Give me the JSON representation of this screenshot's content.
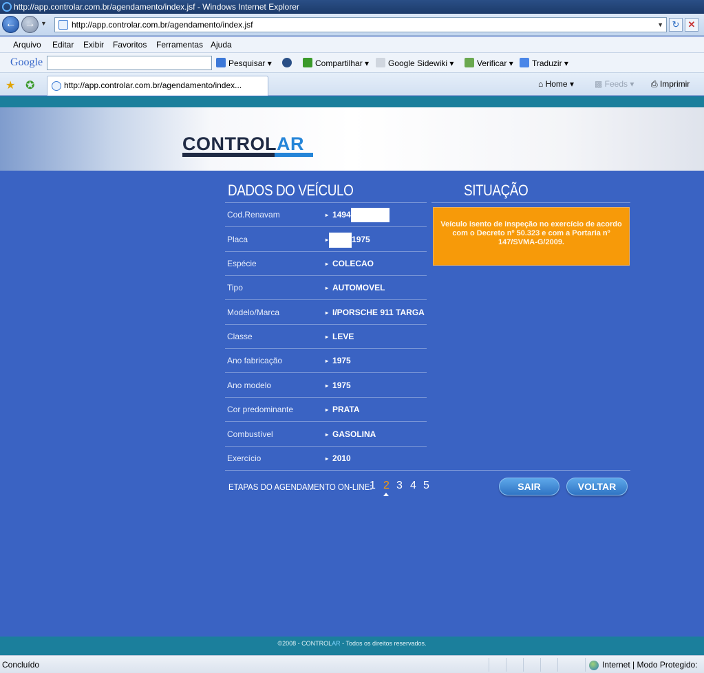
{
  "browser": {
    "window_title": "http://app.controlar.com.br/agendamento/index.jsf - Windows Internet Explorer",
    "address": "http://app.controlar.com.br/agendamento/index.jsf",
    "menu": [
      "Arquivo",
      "Editar",
      "Exibir",
      "Favoritos",
      "Ferramentas",
      "Ajuda"
    ],
    "google_toolbar": {
      "logo": "Google",
      "pesquisar": "Pesquisar",
      "compartilhar": "Compartilhar",
      "sidewiki": "Google Sidewiki",
      "verificar": "Verificar",
      "traduzir": "Traduzir"
    },
    "tab_title": "http://app.controlar.com.br/agendamento/index...",
    "commands": {
      "home": "Home",
      "feeds": "Feeds",
      "imprimir": "Imprimir"
    },
    "status_left": "Concluído",
    "status_right": "Internet | Modo Protegido: A"
  },
  "header": {
    "logo_main": "CONTROL",
    "logo_accent": "AR"
  },
  "vehicle": {
    "title": "DADOS DO VEÍCULO",
    "rows": [
      {
        "label": "Cod.Renavam",
        "value": "1494"
      },
      {
        "label": "Placa",
        "value": "1975"
      },
      {
        "label": "Espécie",
        "value": "COLECAO"
      },
      {
        "label": "Tipo",
        "value": "AUTOMOVEL"
      },
      {
        "label": "Modelo/Marca",
        "value": "I/PORSCHE 911 TARGA"
      },
      {
        "label": "Classe",
        "value": "LEVE"
      },
      {
        "label": "Ano fabricação",
        "value": "1975"
      },
      {
        "label": "Ano modelo",
        "value": "1975"
      },
      {
        "label": "Cor predominante",
        "value": "PRATA"
      },
      {
        "label": "Combustível",
        "value": "GASOLINA"
      },
      {
        "label": "Exercício",
        "value": "2010"
      }
    ]
  },
  "situacao": {
    "title": "SITUAÇÃO",
    "message": "Veículo isento de inspeção no exercício de acordo com o Decreto nº 50.323 e com a Portaria nº 147/SVMA-G/2009."
  },
  "steps": {
    "label": "ETAPAS DO AGENDAMENTO ON-LINE:",
    "items": [
      "1",
      "2",
      "3",
      "4",
      "5"
    ],
    "active": "2"
  },
  "buttons": {
    "sair": "SAIR",
    "voltar": "VOLTAR"
  },
  "footer": {
    "prefix": "©2008 - CONTROL",
    "accent": "AR",
    "suffix": " - Todos os direitos reservados."
  },
  "colors": {
    "page_bg": "#3a63c3",
    "teal_strip": "#1b7f9c",
    "situacao_bg": "#f79a09",
    "logo_dark": "#1f2a44",
    "logo_accent": "#2585d8"
  }
}
